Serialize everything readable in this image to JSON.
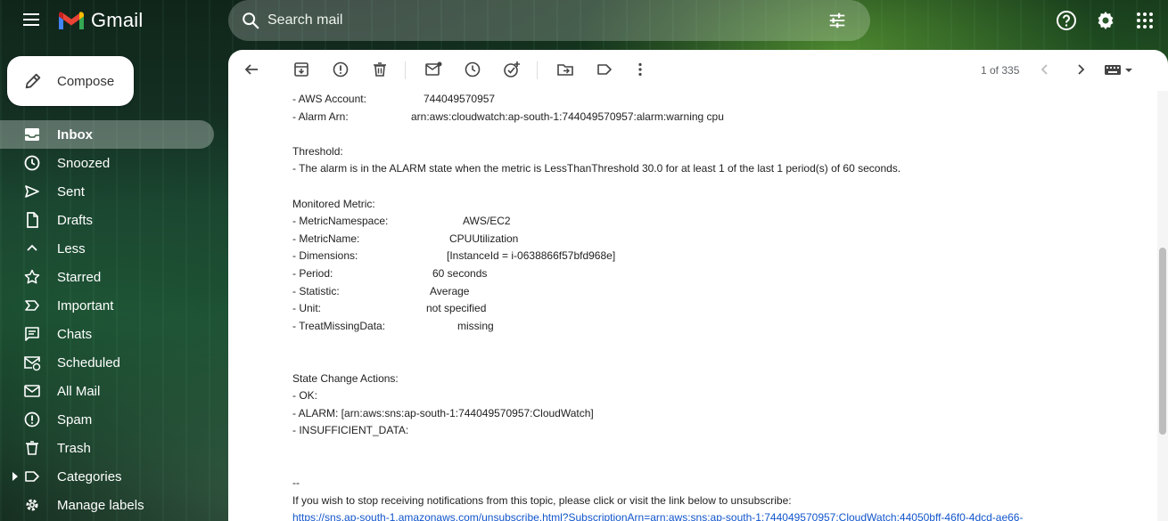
{
  "header": {
    "app_name": "Gmail",
    "search_placeholder": "Search mail"
  },
  "sidebar": {
    "compose_label": "Compose",
    "items": [
      {
        "label": "Inbox",
        "icon": "inbox-icon",
        "active": true
      },
      {
        "label": "Snoozed",
        "icon": "clock-icon"
      },
      {
        "label": "Sent",
        "icon": "send-icon"
      },
      {
        "label": "Drafts",
        "icon": "draft-icon"
      },
      {
        "label": "Less",
        "icon": "chevron-up-icon"
      },
      {
        "label": "Starred",
        "icon": "star-icon"
      },
      {
        "label": "Important",
        "icon": "important-icon"
      },
      {
        "label": "Chats",
        "icon": "chat-icon"
      },
      {
        "label": "Scheduled",
        "icon": "scheduled-icon"
      },
      {
        "label": "All Mail",
        "icon": "all-mail-icon"
      },
      {
        "label": "Spam",
        "icon": "spam-icon"
      },
      {
        "label": "Trash",
        "icon": "trash-icon"
      },
      {
        "label": "Categories",
        "icon": "label-icon"
      },
      {
        "label": "Manage labels",
        "icon": "gear-icon"
      }
    ]
  },
  "toolbar": {
    "pager": "1 of 335"
  },
  "email": {
    "aws_account_key": "- AWS Account:",
    "aws_account_val": "744049570957",
    "alarm_arn_key": "- Alarm Arn:",
    "alarm_arn_val": "arn:aws:cloudwatch:ap-south-1:744049570957:alarm:warning cpu",
    "threshold_head": "Threshold:",
    "threshold_line": "- The alarm is in the ALARM state when the metric is LessThanThreshold 30.0 for at least 1 of the last 1 period(s) of 60 seconds.",
    "metric_head": "Monitored Metric:",
    "metrics": [
      {
        "k": "- MetricNamespace:",
        "v": "AWS/EC2"
      },
      {
        "k": "- MetricName:",
        "v": "CPUUtilization"
      },
      {
        "k": "- Dimensions:",
        "v": "[InstanceId = i-0638866f57bfd968e]"
      },
      {
        "k": "- Period:",
        "v": "60 seconds"
      },
      {
        "k": "- Statistic:",
        "v": "Average"
      },
      {
        "k": "- Unit:",
        "v": "not specified"
      },
      {
        "k": "- TreatMissingData:",
        "v": "missing"
      }
    ],
    "actions_head": "State Change Actions:",
    "actions": [
      "- OK:",
      "- ALARM: [arn:aws:sns:ap-south-1:744049570957:CloudWatch]",
      "- INSUFFICIENT_DATA:"
    ],
    "sig": "--",
    "unsub_text": "If you wish to stop receiving notifications from this topic, please click or visit the link below to unsubscribe:",
    "unsub_link": "https://sns.ap-south-1.amazonaws.com/unsubscribe.html?SubscriptionArn=arn:aws:sns:ap-south-1:744049570957:CloudWatch:44050bff-46f0-4dcd-ae66-"
  }
}
